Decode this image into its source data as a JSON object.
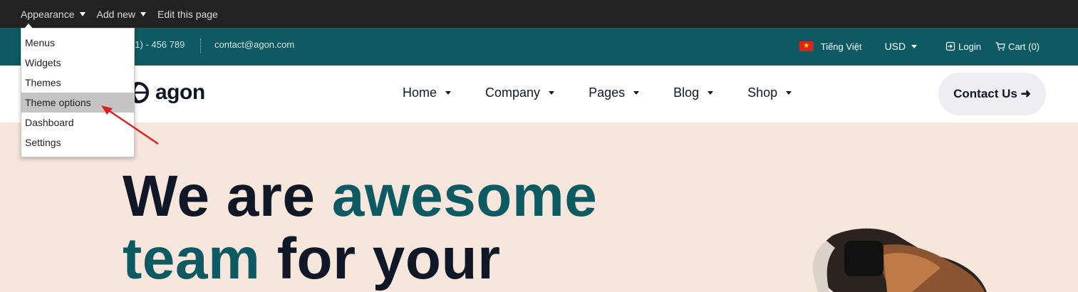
{
  "admin_bar": {
    "appearance": "Appearance",
    "add_new": "Add new",
    "edit_page": "Edit this page"
  },
  "dropdown": {
    "items": [
      "Menus",
      "Widgets",
      "Themes",
      "Theme options",
      "Dashboard",
      "Settings"
    ],
    "highlighted": "Theme options"
  },
  "topbar": {
    "phone_partial": "01) - 456 789",
    "email": "contact@agon.com",
    "language": "Tiếng Việt",
    "currency": "USD",
    "login": "Login",
    "cart": "Cart (0)"
  },
  "header": {
    "logo_text": "agon",
    "nav": [
      "Home",
      "Company",
      "Pages",
      "Blog",
      "Shop"
    ],
    "cta": "Contact Us ➜"
  },
  "hero": {
    "line1_plain": "We are ",
    "line1_accent": "awesome",
    "line2_accent": "team",
    "line2_plain": " for your"
  },
  "colors": {
    "admin_bar_bg": "#222222",
    "topbar_bg": "#0e5a63",
    "accent": "#0e5a63",
    "hero_bg": "#f7e6dc",
    "arrow": "#e02020"
  }
}
